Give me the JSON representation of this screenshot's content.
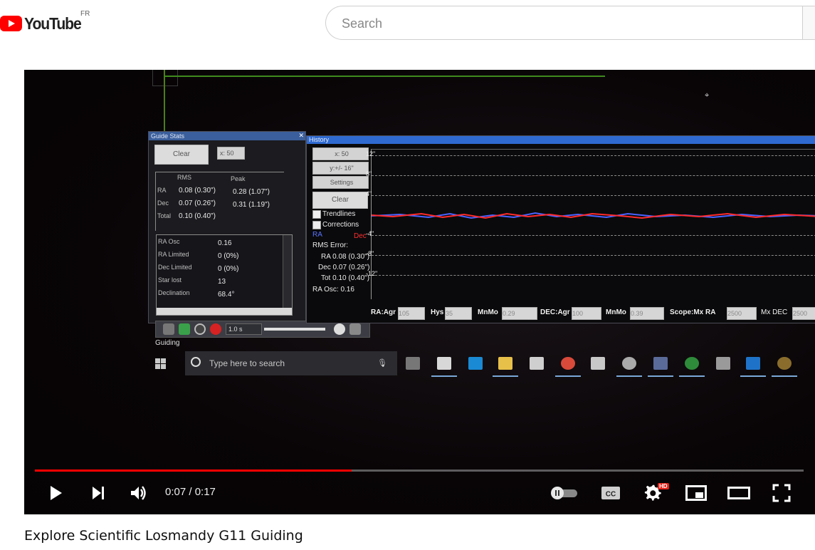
{
  "header": {
    "logo_text": "YouTube",
    "region_code": "FR",
    "search_placeholder": "Search"
  },
  "player": {
    "current_time": "0:07",
    "duration": "0:17",
    "time_display": "0:07 / 0:17",
    "progress_fraction": 0.412,
    "settings_badge": "HD",
    "accent_color": "#ff0000"
  },
  "video_content": {
    "guide_stats": {
      "title": "Guide Stats",
      "clear_label": "Clear",
      "x_select": "x: 50",
      "col_rms": "RMS",
      "col_peak": "Peak",
      "rows": [
        {
          "label": "RA",
          "rms": "0.08 (0.30\")",
          "peak": "0.28 (1.07\")"
        },
        {
          "label": "Dec",
          "rms": "0.07 (0.26\")",
          "peak": "0.31 (1.19\")"
        },
        {
          "label": "Total",
          "rms": "0.10 (0.40\")",
          "peak": ""
        }
      ],
      "osc_rows": [
        {
          "label": "RA Osc",
          "value": "0.16"
        },
        {
          "label": "RA Limited",
          "value": "0 (0%)"
        },
        {
          "label": "Dec Limited",
          "value": "0 (0%)"
        },
        {
          "label": "Star lost",
          "value": "13"
        },
        {
          "label": "Declination",
          "value": "68.4°"
        }
      ],
      "exposure": "1.0 s",
      "status_label": "Guiding"
    },
    "history": {
      "title": "History",
      "x_select": "x: 50",
      "y_select": "y:+/- 16\"",
      "settings_label": "Settings",
      "clear_label": "Clear",
      "trendlines_label": "Trendlines",
      "corrections_label": "Corrections",
      "ra_label": "RA",
      "dec_label": "Dec",
      "rms_error_label": "RMS Error:",
      "rms_ra": "RA 0.08 (0.30\")",
      "rms_dec": "Dec 0.07 (0.26\")",
      "rms_tot": "Tot 0.10 (0.40\")",
      "ra_osc": "RA Osc: 0.16",
      "y_ticks": [
        "12\"",
        "8\"",
        "4\"",
        "-4\"",
        "-8\"",
        "-12\""
      ],
      "ra_color": "#4a63ff",
      "dec_color": "#ff2b2b"
    },
    "params": {
      "ra_agr_label": "RA:Agr",
      "ra_agr_value": "105",
      "hys_label": "Hys",
      "hys_value": "35",
      "mnmo_label": "MnMo",
      "mnmo_value": "0.29",
      "dec_agr_label": "DEC:Agr",
      "dec_agr_value": "100",
      "mnmo2_label": "MnMo",
      "mnmo2_value": "0.39",
      "scope_label": "Scope:Mx RA",
      "scope_value": "2500",
      "mxdec_label": "Mx DEC",
      "mxdec_value": "2500"
    },
    "taskbar": {
      "search_text": "Type here to search"
    }
  },
  "video": {
    "title": "Explore Scientific Losmandy G11 Guiding"
  }
}
